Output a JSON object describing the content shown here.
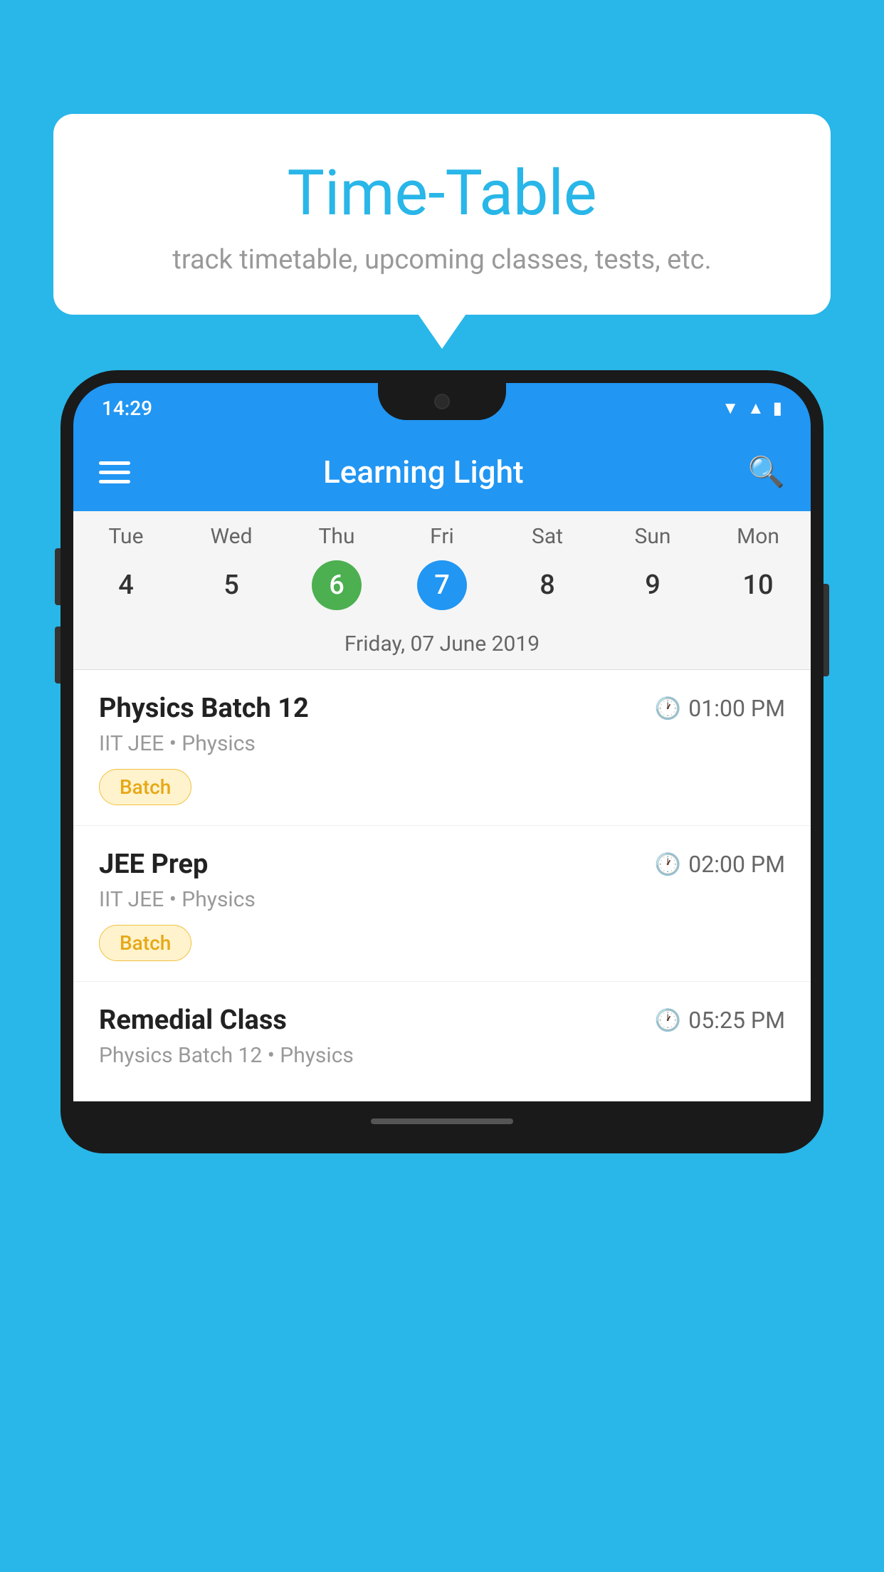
{
  "background_color": "#29b6e8",
  "bubble": {
    "title": "Time-Table",
    "subtitle": "track timetable, upcoming classes, tests, etc."
  },
  "phone": {
    "status_bar": {
      "time": "14:29"
    },
    "app_bar": {
      "title": "Learning Light"
    },
    "calendar": {
      "days": [
        "Tue",
        "Wed",
        "Thu",
        "Fri",
        "Sat",
        "Sun",
        "Mon"
      ],
      "dates": [
        "4",
        "5",
        "6",
        "7",
        "8",
        "9",
        "10"
      ],
      "today_index": 2,
      "selected_index": 3,
      "selected_label": "Friday, 07 June 2019"
    },
    "schedule": [
      {
        "name": "Physics Batch 12",
        "time": "01:00 PM",
        "meta": "IIT JEE • Physics",
        "badge": "Batch"
      },
      {
        "name": "JEE Prep",
        "time": "02:00 PM",
        "meta": "IIT JEE • Physics",
        "badge": "Batch"
      },
      {
        "name": "Remedial Class",
        "time": "05:25 PM",
        "meta": "Physics Batch 12 • Physics",
        "badge": null
      }
    ]
  }
}
